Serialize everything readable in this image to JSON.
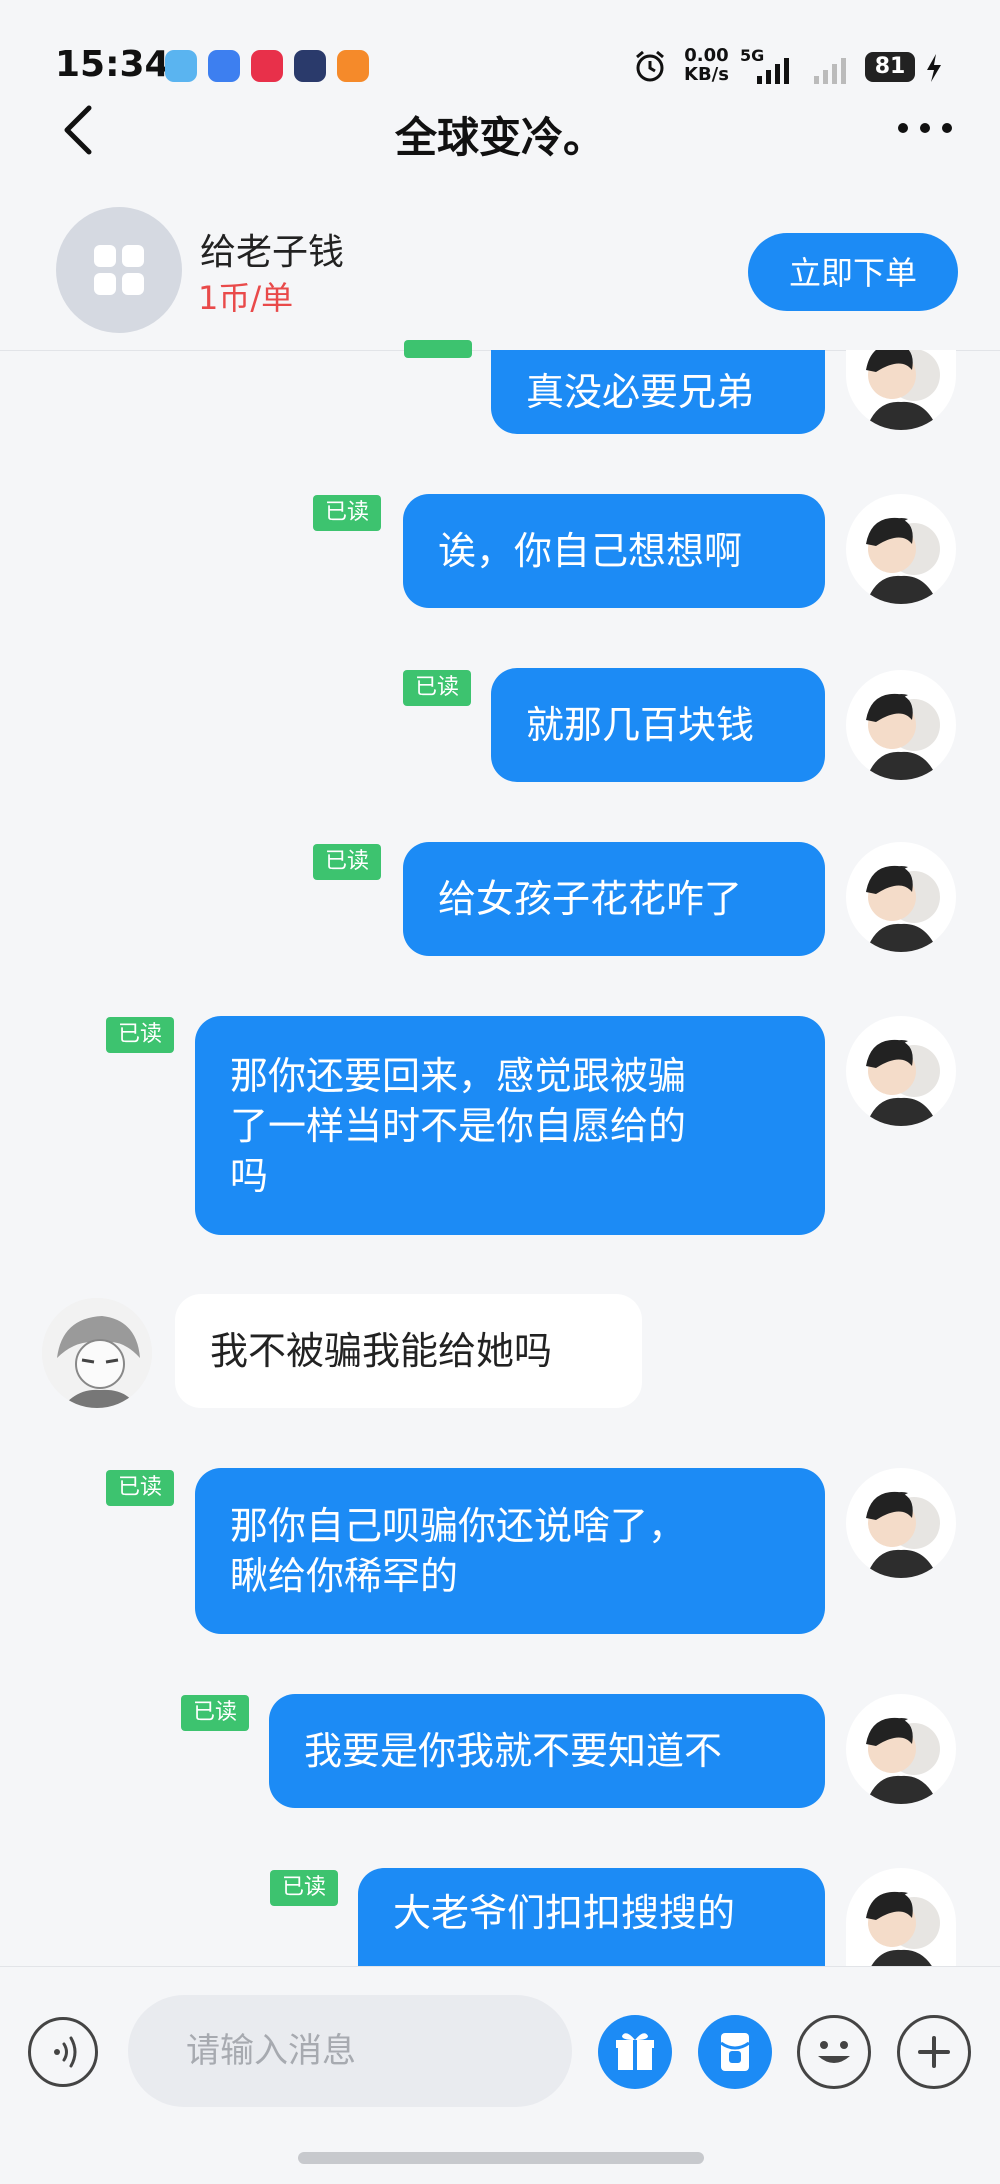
{
  "status_bar": {
    "time": "15:34",
    "net_speed_top": "0.00",
    "net_speed_bottom": "KB/s",
    "network": "5G",
    "battery": "81"
  },
  "nav": {
    "title": "全球变冷。"
  },
  "header": {
    "service_name": "给老子钱",
    "price": "1币/单",
    "order_button": "立即下单"
  },
  "read_label": "已读",
  "messages": [
    {
      "from": "me",
      "text": "真没必要兄弟"
    },
    {
      "from": "me",
      "text": "诶，你自己想想啊"
    },
    {
      "from": "me",
      "text": "就那几百块钱"
    },
    {
      "from": "me",
      "text": "给女孩子花花咋了"
    },
    {
      "from": "me",
      "lines": [
        "那你还要回来，感觉跟被骗",
        "了一样当时不是你自愿给的",
        "吗"
      ]
    },
    {
      "from": "other",
      "text": "我不被骗我能给她吗"
    },
    {
      "from": "me",
      "lines": [
        "那你自己呗骗你还说啥了，",
        "瞅给你稀罕的"
      ]
    },
    {
      "from": "me",
      "text": "我要是你我就不要知道不"
    },
    {
      "from": "me",
      "text": "大老爷们扣扣搜搜的"
    }
  ],
  "input": {
    "placeholder": "请输入消息"
  },
  "colors": {
    "accent": "#1c8bf5",
    "read_badge": "#3dc36f",
    "price": "#e94a4a"
  }
}
